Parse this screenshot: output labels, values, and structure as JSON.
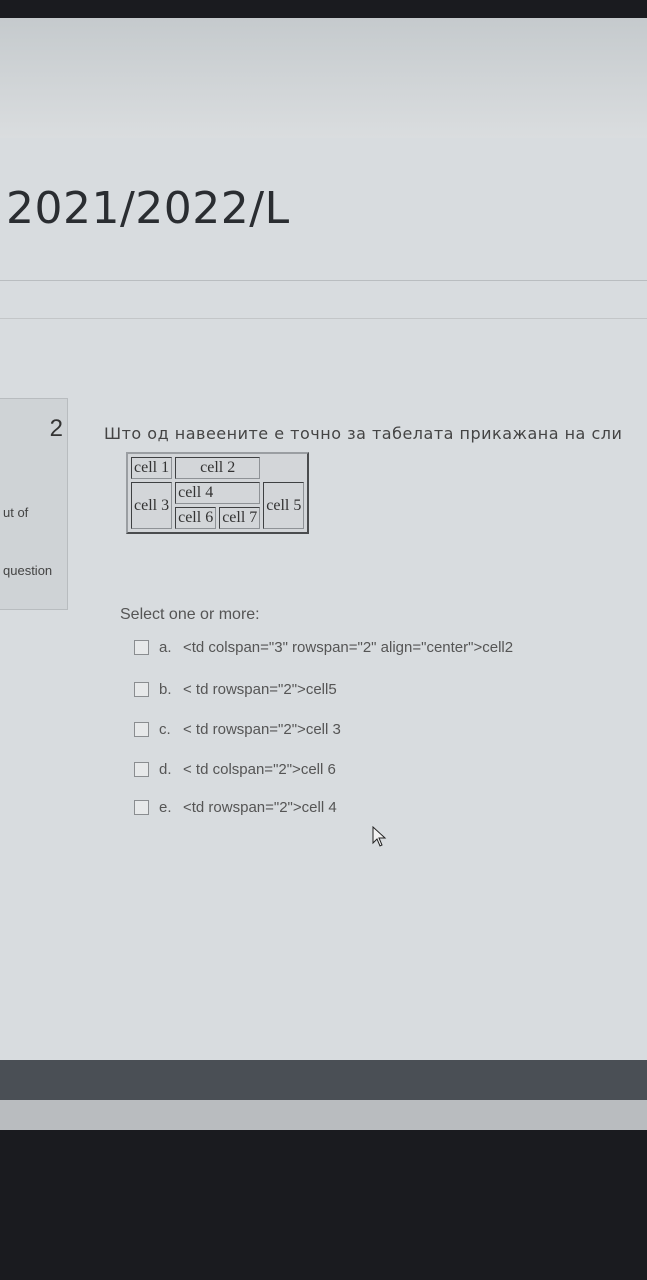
{
  "course": {
    "title": "2021/2022/L"
  },
  "info": {
    "question_number": "2",
    "marks_text": "ut of",
    "flag_text": "question"
  },
  "question": {
    "text": "Што од навеените е точно за табелата прикажана на сли",
    "table": {
      "cell1": "cell 1",
      "cell2": "cell 2",
      "cell3": "cell 3",
      "cell4": "cell 4",
      "cell5": "cell 5",
      "cell6": "cell 6",
      "cell7": "cell 7"
    },
    "prompt": "Select one or more:",
    "options": [
      {
        "letter": "a.",
        "text": "<td colspan=\"3\" rowspan=\"2\" align=\"center\">cell2"
      },
      {
        "letter": "b.",
        "text": "< td rowspan=\"2\">cell5"
      },
      {
        "letter": "c.",
        "text": "< td rowspan=\"2\">cell 3"
      },
      {
        "letter": "d.",
        "text": "< td colspan=\"2\">cell 6"
      },
      {
        "letter": "e.",
        "text": "<td rowspan=\"2\">cell 4"
      }
    ]
  }
}
